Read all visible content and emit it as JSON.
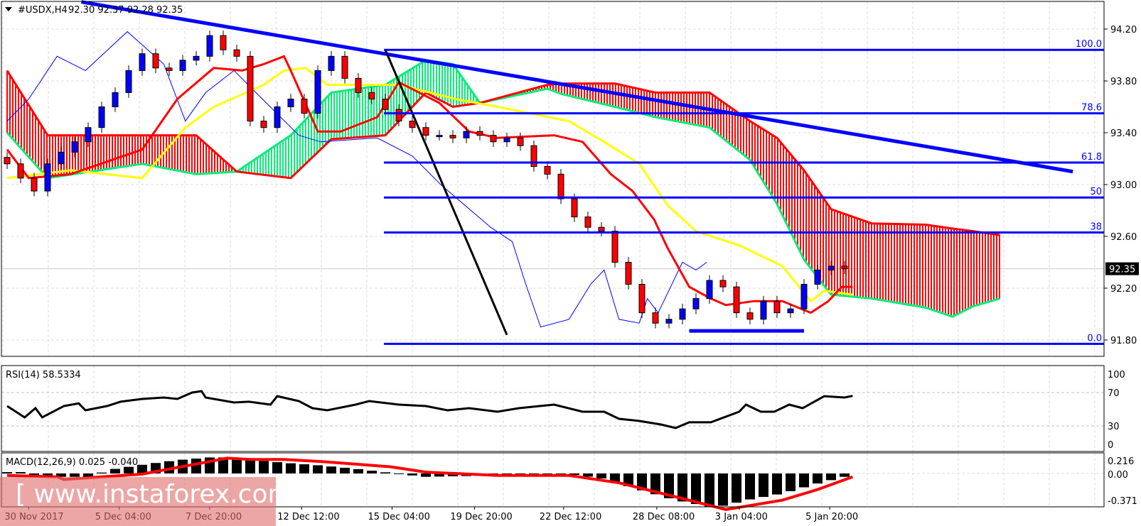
{
  "header": {
    "symbol": "#USDX,H4",
    "ohlc": "92.30 92.37 92.28 92.35"
  },
  "watermark": "[ www.instaforex.com ]",
  "colors": {
    "bull": "#0000ff",
    "bear": "#ff0000",
    "tenkan": "#ff0000",
    "kijun": "#ffff00",
    "chikou": "#0000ff",
    "span_a": "#00ee76",
    "span_b": "#ff0000",
    "fib": "#0000ff",
    "trend": "#0000ff"
  },
  "chart_data": [
    {
      "type": "candlestick",
      "title": "#USDX,H4",
      "price_ticks": [
        "94.20",
        "93.80",
        "93.40",
        "93.00",
        "92.60",
        "92.20",
        "91.80"
      ],
      "current_price": "92.35",
      "x_tick_labels": [
        "30 Nov 2017",
        "5 Dec 04:00",
        "7 Dec 20:00",
        "12 Dec 12:00",
        "15 Dec 04:00",
        "19 Dec 20:00",
        "22 Dec 12:00",
        "28 Dec 08:00",
        "3 Jan 04:00",
        "5 Jan 20:00"
      ],
      "x_tick_bar_index": [
        1.6,
        8.3,
        15,
        21.8,
        28.5,
        34.6,
        41.2,
        48.1,
        54.2,
        60.9
      ],
      "closes": [
        93.16,
        93.05,
        92.95,
        93.16,
        93.25,
        93.33,
        93.44,
        93.6,
        93.71,
        93.88,
        94.01,
        93.9,
        93.88,
        93.96,
        93.99,
        94.15,
        94.04,
        93.99,
        93.49,
        93.44,
        93.6,
        93.66,
        93.55,
        93.88,
        93.99,
        93.82,
        93.71,
        93.66,
        93.58,
        93.49,
        93.44,
        93.38,
        93.38,
        93.36,
        93.41,
        93.38,
        93.33,
        93.36,
        93.3,
        93.14,
        93.08,
        92.89,
        92.75,
        92.67,
        92.64,
        92.4,
        92.23,
        92.01,
        91.93,
        91.96,
        92.04,
        92.12,
        92.26,
        92.21,
        92.01,
        91.96,
        92.1,
        92.01,
        92.04,
        92.23,
        92.34,
        92.37,
        92.35
      ],
      "ichimoku": {
        "tenkan": [
          [
            0,
            93.27
          ],
          [
            1.6,
            93.05
          ],
          [
            4.7,
            93.08
          ],
          [
            10,
            93.27
          ],
          [
            12.6,
            93.66
          ],
          [
            15.3,
            93.9
          ],
          [
            17.4,
            93.88
          ],
          [
            19,
            93.93
          ],
          [
            20.5,
            93.99
          ],
          [
            21,
            93.88
          ],
          [
            23,
            93.41
          ],
          [
            24.7,
            93.41
          ],
          [
            27.4,
            93.52
          ],
          [
            29,
            93.79
          ],
          [
            32,
            93.63
          ],
          [
            34.2,
            93.41
          ],
          [
            36.3,
            93.36
          ],
          [
            40.5,
            93.38
          ],
          [
            42.6,
            93.33
          ],
          [
            44.7,
            93.08
          ],
          [
            46.3,
            92.95
          ],
          [
            47.9,
            92.73
          ],
          [
            48.9,
            92.51
          ],
          [
            50.5,
            92.21
          ],
          [
            52.1,
            92.12
          ],
          [
            53.2,
            92.07
          ],
          [
            55.3,
            92.1
          ],
          [
            57.4,
            92.1
          ],
          [
            59.5,
            92.01
          ],
          [
            60.8,
            92.1
          ],
          [
            61.8,
            92.21
          ],
          [
            62.6,
            92.21
          ]
        ],
        "kijun": [
          [
            0,
            93.05
          ],
          [
            4.7,
            93.11
          ],
          [
            10,
            93.05
          ],
          [
            13.2,
            93.44
          ],
          [
            15.3,
            93.6
          ],
          [
            19,
            93.77
          ],
          [
            20.5,
            93.88
          ],
          [
            22.1,
            93.9
          ],
          [
            23.7,
            93.77
          ],
          [
            29,
            93.77
          ],
          [
            33.2,
            93.66
          ],
          [
            36.3,
            93.6
          ],
          [
            41.6,
            93.49
          ],
          [
            44.2,
            93.33
          ],
          [
            46.8,
            93.16
          ],
          [
            48.9,
            92.84
          ],
          [
            51,
            92.64
          ],
          [
            54.2,
            92.53
          ],
          [
            57.4,
            92.37
          ],
          [
            59.5,
            92.1
          ],
          [
            60.5,
            92.18
          ],
          [
            62.6,
            92.15
          ]
        ],
        "chikou": [
          [
            0,
            93.49
          ],
          [
            1.6,
            93.66
          ],
          [
            3.7,
            93.99
          ],
          [
            5.8,
            93.88
          ],
          [
            8.9,
            94.18
          ],
          [
            11.6,
            93.93
          ],
          [
            13.2,
            93.49
          ],
          [
            14.7,
            93.71
          ],
          [
            16.8,
            93.88
          ],
          [
            18.9,
            93.66
          ],
          [
            21.6,
            93.38
          ],
          [
            23.2,
            93.33
          ],
          [
            27.4,
            93.36
          ],
          [
            30,
            93.22
          ],
          [
            32.1,
            93.0
          ],
          [
            35.8,
            92.67
          ],
          [
            37.4,
            92.56
          ],
          [
            38.4,
            92.23
          ],
          [
            39.5,
            91.9
          ],
          [
            41.6,
            91.96
          ],
          [
            43.2,
            92.23
          ],
          [
            44.2,
            92.34
          ],
          [
            45.3,
            91.96
          ],
          [
            46.8,
            91.93
          ],
          [
            47.4,
            92.12
          ],
          [
            48.2,
            92.01
          ],
          [
            50,
            92.4
          ],
          [
            51,
            92.34
          ],
          [
            51.8,
            92.4
          ]
        ],
        "cloud": [
          [
            0,
            93.4,
            93.88
          ],
          [
            3,
            93.05,
            93.38
          ],
          [
            10,
            93.16,
            93.38
          ],
          [
            14,
            93.08,
            93.38
          ],
          [
            17,
            93.1,
            93.1
          ],
          [
            21,
            93.38,
            93.05
          ],
          [
            24,
            93.71,
            93.35
          ],
          [
            28,
            93.77,
            93.38
          ],
          [
            31,
            93.96,
            93.71
          ],
          [
            33,
            93.93,
            93.6
          ],
          [
            35,
            93.63,
            93.63
          ],
          [
            40,
            93.74,
            93.77
          ],
          [
            41,
            93.7,
            93.78
          ],
          [
            45,
            93.6,
            93.78
          ],
          [
            48,
            93.52,
            93.71
          ],
          [
            52,
            93.44,
            93.71
          ],
          [
            55,
            93.19,
            93.49
          ],
          [
            57,
            92.85,
            93.36
          ],
          [
            59,
            92.42,
            93.11
          ],
          [
            61,
            92.15,
            92.81
          ],
          [
            64,
            92.12,
            92.7
          ],
          [
            68,
            92.05,
            92.69
          ],
          [
            70,
            91.98,
            92.66
          ],
          [
            71.5,
            92.06,
            92.64
          ],
          [
            73.5,
            92.12,
            92.61
          ]
        ]
      },
      "trendline": [
        [
          5.5,
          94.41
        ],
        [
          78.9,
          93.1
        ]
      ],
      "swing_line": [
        [
          28,
          94.04
        ],
        [
          37,
          91.84
        ]
      ],
      "support_line": [
        [
          50.5,
          91.87
        ],
        [
          59,
          91.87
        ]
      ],
      "fibonacci": {
        "start_index": 27.9,
        "levels": [
          {
            "label": "100.0",
            "price": 94.04
          },
          {
            "label": "78.6",
            "price": 93.55
          },
          {
            "label": "61.8",
            "price": 93.17
          },
          {
            "label": "50",
            "price": 92.9
          },
          {
            "label": "38",
            "price": 92.63
          },
          {
            "label": "0.0",
            "price": 91.77
          }
        ]
      }
    },
    {
      "type": "line",
      "title": "RSI(14) 58.5334",
      "ticks": [
        "100",
        "70",
        "30",
        "0"
      ],
      "levels": [
        70,
        30
      ],
      "values": [
        [
          0,
          53.8
        ],
        [
          1.3,
          40.2
        ],
        [
          2.1,
          51.3
        ],
        [
          2.6,
          40.2
        ],
        [
          4.2,
          53.8
        ],
        [
          5.3,
          57
        ],
        [
          5.8,
          48.7
        ],
        [
          7.4,
          53.8
        ],
        [
          8.4,
          59
        ],
        [
          10,
          62.3
        ],
        [
          11.6,
          64
        ],
        [
          12.6,
          62.3
        ],
        [
          13.7,
          70
        ],
        [
          14.4,
          71.7
        ],
        [
          14.7,
          64
        ],
        [
          16.8,
          58.1
        ],
        [
          17.9,
          59
        ],
        [
          19.5,
          55.5
        ],
        [
          20,
          65.7
        ],
        [
          21.6,
          59.8
        ],
        [
          22.6,
          51.3
        ],
        [
          23.7,
          48.7
        ],
        [
          25.8,
          55.5
        ],
        [
          26.8,
          59.8
        ],
        [
          29,
          55.5
        ],
        [
          31,
          53.8
        ],
        [
          32.6,
          48.7
        ],
        [
          34.2,
          51.3
        ],
        [
          36.3,
          47
        ],
        [
          37.9,
          51.3
        ],
        [
          40.5,
          55.5
        ],
        [
          42.6,
          47
        ],
        [
          44.2,
          47
        ],
        [
          45.3,
          38.5
        ],
        [
          46.8,
          36
        ],
        [
          48.4,
          31.7
        ],
        [
          49.5,
          27.5
        ],
        [
          50.5,
          34.3
        ],
        [
          52.1,
          34.3
        ],
        [
          54.2,
          47
        ],
        [
          54.7,
          55.5
        ],
        [
          55.8,
          47
        ],
        [
          56.8,
          47
        ],
        [
          57.9,
          55.5
        ],
        [
          58.9,
          51.3
        ],
        [
          60.5,
          65.7
        ],
        [
          62,
          64
        ],
        [
          62.6,
          66
        ]
      ]
    },
    {
      "type": "bar",
      "title": "MACD(12,26,9) 0.025 -0.040",
      "ticks": [
        "0.216",
        "0.00",
        "-0.371"
      ],
      "histogram": [
        [
          0,
          0.02
        ],
        [
          1.5,
          0.02
        ],
        [
          2.1,
          -0.05
        ],
        [
          6.3,
          -0.05
        ],
        [
          7.4,
          0.05
        ],
        [
          10,
          0.13
        ],
        [
          12.6,
          0.2
        ],
        [
          15.3,
          0.245
        ],
        [
          16.8,
          0.235
        ],
        [
          18.4,
          0.2
        ],
        [
          20.5,
          0.16
        ],
        [
          23.2,
          0.12
        ],
        [
          25.8,
          0.07
        ],
        [
          27.9,
          0.02
        ],
        [
          29,
          -0.01
        ],
        [
          31,
          -0.05
        ],
        [
          36.3,
          -0.03
        ],
        [
          41.6,
          -0.01
        ],
        [
          44.2,
          -0.08
        ],
        [
          46.8,
          -0.24
        ],
        [
          49.5,
          -0.4
        ],
        [
          52.1,
          -0.5
        ],
        [
          53.2,
          -0.48
        ],
        [
          54.7,
          -0.4
        ],
        [
          57.4,
          -0.3
        ],
        [
          60,
          -0.15
        ],
        [
          62.6,
          -0.02
        ]
      ],
      "signal": [
        [
          0,
          -0.03
        ],
        [
          3.7,
          -0.05
        ],
        [
          4.2,
          -0.09
        ],
        [
          10,
          -0.01
        ],
        [
          16.3,
          0.23
        ],
        [
          18,
          0.21
        ],
        [
          20.5,
          0.21
        ],
        [
          23.2,
          0.18
        ],
        [
          28.4,
          0.1
        ],
        [
          31,
          0.02
        ],
        [
          36.3,
          -0.03
        ],
        [
          41.6,
          -0.03
        ],
        [
          45.3,
          -0.14
        ],
        [
          49.5,
          -0.35
        ],
        [
          53.2,
          -0.54
        ],
        [
          57.4,
          -0.4
        ],
        [
          60,
          -0.24
        ],
        [
          62.6,
          -0.05
        ]
      ]
    }
  ]
}
